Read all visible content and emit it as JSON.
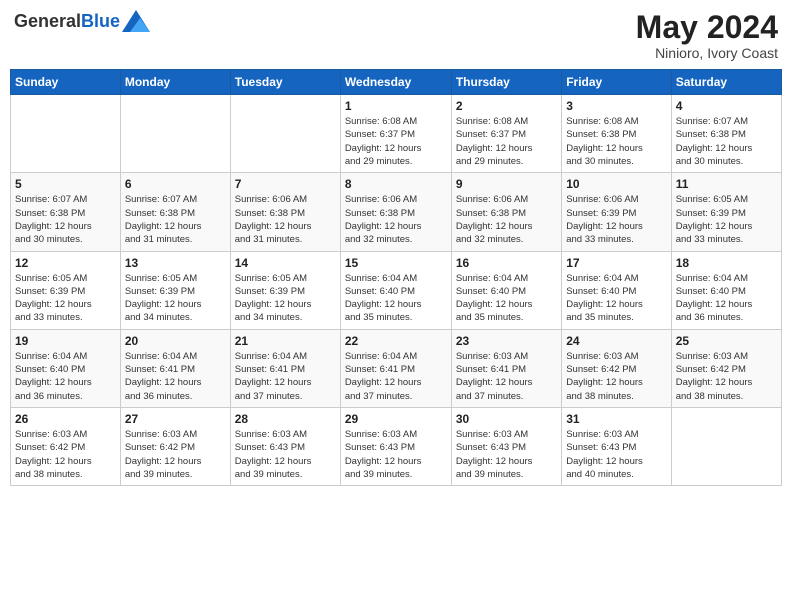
{
  "header": {
    "logo": {
      "general": "General",
      "blue": "Blue"
    },
    "title": "May 2024",
    "location": "Ninioro, Ivory Coast"
  },
  "weekdays": [
    "Sunday",
    "Monday",
    "Tuesday",
    "Wednesday",
    "Thursday",
    "Friday",
    "Saturday"
  ],
  "weeks": [
    [
      {
        "day": "",
        "info": ""
      },
      {
        "day": "",
        "info": ""
      },
      {
        "day": "",
        "info": ""
      },
      {
        "day": "1",
        "info": "Sunrise: 6:08 AM\nSunset: 6:37 PM\nDaylight: 12 hours\nand 29 minutes."
      },
      {
        "day": "2",
        "info": "Sunrise: 6:08 AM\nSunset: 6:37 PM\nDaylight: 12 hours\nand 29 minutes."
      },
      {
        "day": "3",
        "info": "Sunrise: 6:08 AM\nSunset: 6:38 PM\nDaylight: 12 hours\nand 30 minutes."
      },
      {
        "day": "4",
        "info": "Sunrise: 6:07 AM\nSunset: 6:38 PM\nDaylight: 12 hours\nand 30 minutes."
      }
    ],
    [
      {
        "day": "5",
        "info": "Sunrise: 6:07 AM\nSunset: 6:38 PM\nDaylight: 12 hours\nand 30 minutes."
      },
      {
        "day": "6",
        "info": "Sunrise: 6:07 AM\nSunset: 6:38 PM\nDaylight: 12 hours\nand 31 minutes."
      },
      {
        "day": "7",
        "info": "Sunrise: 6:06 AM\nSunset: 6:38 PM\nDaylight: 12 hours\nand 31 minutes."
      },
      {
        "day": "8",
        "info": "Sunrise: 6:06 AM\nSunset: 6:38 PM\nDaylight: 12 hours\nand 32 minutes."
      },
      {
        "day": "9",
        "info": "Sunrise: 6:06 AM\nSunset: 6:38 PM\nDaylight: 12 hours\nand 32 minutes."
      },
      {
        "day": "10",
        "info": "Sunrise: 6:06 AM\nSunset: 6:39 PM\nDaylight: 12 hours\nand 33 minutes."
      },
      {
        "day": "11",
        "info": "Sunrise: 6:05 AM\nSunset: 6:39 PM\nDaylight: 12 hours\nand 33 minutes."
      }
    ],
    [
      {
        "day": "12",
        "info": "Sunrise: 6:05 AM\nSunset: 6:39 PM\nDaylight: 12 hours\nand 33 minutes."
      },
      {
        "day": "13",
        "info": "Sunrise: 6:05 AM\nSunset: 6:39 PM\nDaylight: 12 hours\nand 34 minutes."
      },
      {
        "day": "14",
        "info": "Sunrise: 6:05 AM\nSunset: 6:39 PM\nDaylight: 12 hours\nand 34 minutes."
      },
      {
        "day": "15",
        "info": "Sunrise: 6:04 AM\nSunset: 6:40 PM\nDaylight: 12 hours\nand 35 minutes."
      },
      {
        "day": "16",
        "info": "Sunrise: 6:04 AM\nSunset: 6:40 PM\nDaylight: 12 hours\nand 35 minutes."
      },
      {
        "day": "17",
        "info": "Sunrise: 6:04 AM\nSunset: 6:40 PM\nDaylight: 12 hours\nand 35 minutes."
      },
      {
        "day": "18",
        "info": "Sunrise: 6:04 AM\nSunset: 6:40 PM\nDaylight: 12 hours\nand 36 minutes."
      }
    ],
    [
      {
        "day": "19",
        "info": "Sunrise: 6:04 AM\nSunset: 6:40 PM\nDaylight: 12 hours\nand 36 minutes."
      },
      {
        "day": "20",
        "info": "Sunrise: 6:04 AM\nSunset: 6:41 PM\nDaylight: 12 hours\nand 36 minutes."
      },
      {
        "day": "21",
        "info": "Sunrise: 6:04 AM\nSunset: 6:41 PM\nDaylight: 12 hours\nand 37 minutes."
      },
      {
        "day": "22",
        "info": "Sunrise: 6:04 AM\nSunset: 6:41 PM\nDaylight: 12 hours\nand 37 minutes."
      },
      {
        "day": "23",
        "info": "Sunrise: 6:03 AM\nSunset: 6:41 PM\nDaylight: 12 hours\nand 37 minutes."
      },
      {
        "day": "24",
        "info": "Sunrise: 6:03 AM\nSunset: 6:42 PM\nDaylight: 12 hours\nand 38 minutes."
      },
      {
        "day": "25",
        "info": "Sunrise: 6:03 AM\nSunset: 6:42 PM\nDaylight: 12 hours\nand 38 minutes."
      }
    ],
    [
      {
        "day": "26",
        "info": "Sunrise: 6:03 AM\nSunset: 6:42 PM\nDaylight: 12 hours\nand 38 minutes."
      },
      {
        "day": "27",
        "info": "Sunrise: 6:03 AM\nSunset: 6:42 PM\nDaylight: 12 hours\nand 39 minutes."
      },
      {
        "day": "28",
        "info": "Sunrise: 6:03 AM\nSunset: 6:43 PM\nDaylight: 12 hours\nand 39 minutes."
      },
      {
        "day": "29",
        "info": "Sunrise: 6:03 AM\nSunset: 6:43 PM\nDaylight: 12 hours\nand 39 minutes."
      },
      {
        "day": "30",
        "info": "Sunrise: 6:03 AM\nSunset: 6:43 PM\nDaylight: 12 hours\nand 39 minutes."
      },
      {
        "day": "31",
        "info": "Sunrise: 6:03 AM\nSunset: 6:43 PM\nDaylight: 12 hours\nand 40 minutes."
      },
      {
        "day": "",
        "info": ""
      }
    ]
  ]
}
